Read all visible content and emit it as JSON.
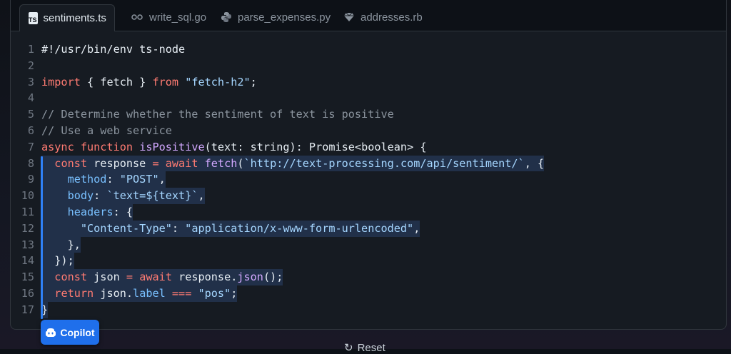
{
  "tabs": [
    {
      "label": "sentiments.ts",
      "icon": "typescript-icon",
      "badge": "TS"
    },
    {
      "label": "write_sql.go",
      "icon": "go-icon"
    },
    {
      "label": "parse_expenses.py",
      "icon": "python-icon"
    },
    {
      "label": "addresses.rb",
      "icon": "ruby-icon"
    }
  ],
  "line_numbers": [
    "1",
    "2",
    "3",
    "4",
    "5",
    "6",
    "7",
    "8",
    "9",
    "10",
    "11",
    "12",
    "13",
    "14",
    "15",
    "16",
    "17"
  ],
  "code": {
    "l1": "#!/usr/bin/env ts-node",
    "l3_import": "import",
    "l3_mid": " { fetch } ",
    "l3_from": "from",
    "l3_str": "\"fetch-h2\"",
    "l3_end": ";",
    "l5": "// Determine whether the sentiment of text is positive",
    "l6": "// Use a web service",
    "l7_async": "async",
    "l7_function": "function",
    "l7_name": "isPositive",
    "l7_rest": "(text: string): Promise<boolean> {",
    "l8_indent": "  ",
    "l8_const": "const",
    "l8_var": " response ",
    "l8_eq": "=",
    "l8_await": "await",
    "l8_fetch": "fetch",
    "l8_paren": "(",
    "l8_str": "`http://text-processing.com/api/sentiment/`",
    "l8_end": ", {",
    "l9_key": "    method",
    "l9_colon": ": ",
    "l9_str": "\"POST\"",
    "l9_end": ",",
    "l10_key": "    body",
    "l10_colon": ": ",
    "l10_str": "`text=${text}`",
    "l10_end": ",",
    "l11_key": "    headers",
    "l11_end": ": {",
    "l12_str1": "      \"Content-Type\"",
    "l12_colon": ": ",
    "l12_str2": "\"application/x-www-form-urlencoded\"",
    "l12_end": ",",
    "l13": "    },",
    "l14": "  });",
    "l15_indent": "  ",
    "l15_const": "const",
    "l15_var": " json ",
    "l15_eq": "=",
    "l15_await": "await",
    "l15_obj": " response.",
    "l15_fn": "json",
    "l15_end": "();",
    "l16_indent": "  ",
    "l16_return": "return",
    "l16_obj": " json.",
    "l16_prop": "label",
    "l16_op": " === ",
    "l16_str": "\"pos\"",
    "l16_end": ";",
    "l17": "}"
  },
  "copilot_label": "Copilot",
  "reset_label": "Reset",
  "colors": {
    "accent": "#1f6feb",
    "keyword": "#ff7b72",
    "string": "#a5d6ff",
    "comment": "#8b949e"
  }
}
